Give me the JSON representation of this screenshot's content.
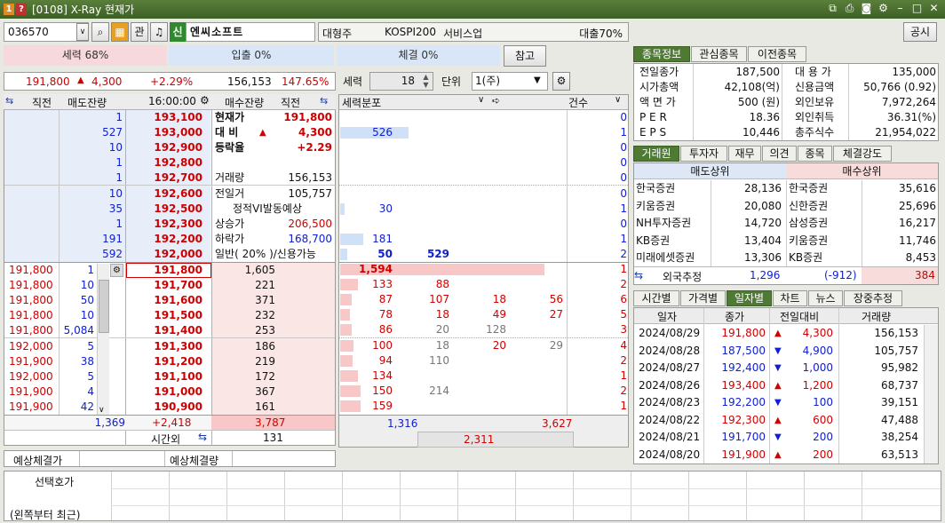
{
  "window": {
    "title": "[0108] X-Ray 현재가"
  },
  "toolbar": {
    "code": "036570",
    "gwan": "관",
    "sin": "신",
    "name": "엔씨소프트",
    "info": [
      "대형주",
      "KOSPI200",
      "서비스업"
    ],
    "loan": "대출70%",
    "notice": "공시"
  },
  "strength": {
    "seryeok": "세력 68%",
    "inout": "입출 0%",
    "chegyeol": "체결 0%",
    "ref": "참고"
  },
  "quote": {
    "price": "191,800",
    "change": "4,300",
    "rate": "+2.29%",
    "volume": "156,153",
    "ratio": "147.65%"
  },
  "seryeok_ctrl": {
    "label": "세력",
    "value": "18",
    "unit_label": "단위",
    "unit": "1(주)"
  },
  "ob_header": {
    "jikjeon1": "직전",
    "sell_rem": "매도잔량",
    "time": "16:00:00",
    "buy_rem": "매수잔량",
    "jikjeon2": "직전"
  },
  "ask": [
    {
      "rem": "1",
      "price": "193,100"
    },
    {
      "rem": "527",
      "price": "193,000"
    },
    {
      "rem": "10",
      "price": "192,900"
    },
    {
      "rem": "1",
      "price": "192,800"
    },
    {
      "rem": "1",
      "price": "192,700"
    },
    {
      "rem": "10",
      "price": "192,600"
    },
    {
      "rem": "35",
      "price": "192,500"
    },
    {
      "rem": "1",
      "price": "192,300"
    },
    {
      "rem": "191",
      "price": "192,200"
    },
    {
      "rem": "592",
      "price": "192,000"
    }
  ],
  "info": [
    {
      "k": "현재가",
      "v": "191,800"
    },
    {
      "k": "대 비",
      "arrow": "▲",
      "v": "4,300"
    },
    {
      "k": "등락율",
      "v": "+2.29"
    },
    {
      "k": "",
      "v": ""
    },
    {
      "k": "거래량",
      "v": "156,153"
    },
    {
      "k": "전일거",
      "v": "105,757"
    },
    {
      "k": "정적VI발동예상",
      "v": ""
    },
    {
      "k": "상승가",
      "v": "206,500"
    },
    {
      "k": "하락가",
      "v": "168,700"
    },
    {
      "k": "일반( 20% )/신용가능",
      "v": ""
    }
  ],
  "bid": [
    {
      "prev": "191,800",
      "rem": "1",
      "price": "191,800",
      "brem": "1,605"
    },
    {
      "prev": "191,800",
      "rem": "10",
      "price": "191,700",
      "brem": "221"
    },
    {
      "prev": "191,800",
      "rem": "50",
      "price": "191,600",
      "brem": "371"
    },
    {
      "prev": "191,800",
      "rem": "10",
      "price": "191,500",
      "brem": "232"
    },
    {
      "prev": "191,800",
      "rem": "5,084",
      "price": "191,400",
      "brem": "253"
    },
    {
      "prev": "192,000",
      "rem": "5",
      "price": "191,300",
      "brem": "186"
    },
    {
      "prev": "191,900",
      "rem": "38",
      "price": "191,200",
      "brem": "219"
    },
    {
      "prev": "192,000",
      "rem": "5",
      "price": "191,100",
      "brem": "172"
    },
    {
      "prev": "191,900",
      "rem": "4",
      "price": "191,000",
      "brem": "367"
    },
    {
      "prev": "191,900",
      "rem": "42",
      "price": "190,900",
      "brem": "161"
    }
  ],
  "ob_totals": {
    "sell": "1,369",
    "diff": "+2,418",
    "buy": "3,787",
    "after_label": "시간외",
    "after_val": "131"
  },
  "expected": {
    "price_label": "예상체결가",
    "vol_label": "예상체결량"
  },
  "dist_header": {
    "title": "세력분포",
    "count": "건수"
  },
  "dist": [
    {
      "a": "",
      "b": "",
      "c": "",
      "d": "",
      "n": "0"
    },
    {
      "a": "526",
      "b": "",
      "c": "",
      "d": "",
      "n": "1"
    },
    {
      "a": "",
      "b": "",
      "c": "",
      "d": "",
      "n": "0"
    },
    {
      "a": "",
      "b": "",
      "c": "",
      "d": "",
      "n": "0"
    },
    {
      "a": "",
      "b": "",
      "c": "",
      "d": "",
      "n": "0"
    },
    {
      "a": "",
      "b": "",
      "c": "",
      "d": "",
      "n": "0"
    },
    {
      "a": "30",
      "b": "",
      "c": "",
      "d": "",
      "n": "1"
    },
    {
      "a": "",
      "b": "",
      "c": "",
      "d": "",
      "n": "0"
    },
    {
      "a": "181",
      "b": "",
      "c": "",
      "d": "",
      "n": "1"
    },
    {
      "a": "50",
      "b": "529",
      "c": "",
      "d": "",
      "n": "2"
    },
    {
      "a": "1,594",
      "b": "",
      "c": "",
      "d": "",
      "n": "1"
    },
    {
      "a": "133",
      "b": "88",
      "c": "",
      "d": "",
      "n": "2"
    },
    {
      "a": "87",
      "b": "107",
      "c": "18",
      "d": "56",
      "n": "6"
    },
    {
      "a": "78",
      "b": "18",
      "c": "49",
      "d": "27",
      "n": "5"
    },
    {
      "a": "86",
      "b": "20",
      "c": "128",
      "d": "",
      "n": "3"
    },
    {
      "a": "100",
      "b": "18",
      "c": "20",
      "d": "29",
      "n": "4"
    },
    {
      "a": "94",
      "b": "110",
      "c": "",
      "d": "",
      "n": "2"
    },
    {
      "a": "134",
      "b": "",
      "c": "",
      "d": "",
      "n": "1"
    },
    {
      "a": "150",
      "b": "214",
      "c": "",
      "d": "",
      "n": "2"
    },
    {
      "a": "159",
      "b": "",
      "c": "",
      "d": "",
      "n": "1"
    }
  ],
  "dist_bar": [
    0,
    0.3,
    0,
    0,
    0,
    0,
    0.02,
    0,
    0.1,
    0.03,
    0.9,
    0.08,
    0.05,
    0.045,
    0.05,
    0.06,
    0.055,
    0.08,
    0.09,
    0.09
  ],
  "dist_totals": {
    "a": "1,316",
    "b": "3,627",
    "c": "2,311"
  },
  "tabs1": [
    "종목정보",
    "관심종목",
    "이전종목"
  ],
  "stockinfo": [
    {
      "k1": "전일종가",
      "v1": "187,500",
      "k2": "대 용 가",
      "v2": "135,000"
    },
    {
      "k1": "시가총액",
      "v1": "42,108(억)",
      "k2": "신용금액",
      "v2": "50,766  (0.92)"
    },
    {
      "k1": "액 면 가",
      "v1": "500 (원)",
      "k2": "외인보유",
      "v2": "7,972,264"
    },
    {
      "k1": "P E R",
      "v1": "18.36",
      "k2": "외인취득",
      "v2": "36.31(%)"
    },
    {
      "k1": "E P S",
      "v1": "10,446",
      "k2": "총주식수",
      "v2": "21,954,022"
    }
  ],
  "tabs2": [
    "거래원",
    "투자자",
    "재무",
    "의견",
    "종목",
    "체결강도"
  ],
  "broker_header": {
    "sell": "매도상위",
    "buy": "매수상위"
  },
  "brokers": [
    {
      "s": "한국증권",
      "sv": "28,136",
      "b": "한국증권",
      "bv": "35,616"
    },
    {
      "s": "키움증권",
      "sv": "20,080",
      "b": "신한증권",
      "bv": "25,696"
    },
    {
      "s": "NH투자증권",
      "sv": "14,720",
      "b": "삼성증권",
      "bv": "16,217"
    },
    {
      "s": "KB증권",
      "sv": "13,404",
      "b": "키움증권",
      "bv": "11,746"
    },
    {
      "s": "미래에셋증권",
      "sv": "13,306",
      "b": "KB증권",
      "bv": "8,453"
    }
  ],
  "foreign": {
    "label": "외국추정",
    "sell": "1,296",
    "net": "(-912)",
    "buy": "384"
  },
  "tabs3": [
    "시간별",
    "가격별",
    "일자별",
    "차트",
    "뉴스",
    "장중추정"
  ],
  "daily_header": {
    "date": "일자",
    "close": "종가",
    "change": "전일대비",
    "volume": "거래량"
  },
  "daily": [
    {
      "date": "2024/08/29",
      "close": "191,800",
      "dir": "▲",
      "chg": "4,300",
      "vol": "156,153",
      "up": true
    },
    {
      "date": "2024/08/28",
      "close": "187,500",
      "dir": "▼",
      "chg": "4,900",
      "vol": "105,757",
      "up": false
    },
    {
      "date": "2024/08/27",
      "close": "192,400",
      "dir": "▼",
      "chg": "1,000",
      "vol": "95,982",
      "up": false
    },
    {
      "date": "2024/08/26",
      "close": "193,400",
      "dir": "▲",
      "chg": "1,200",
      "vol": "68,737",
      "up": true
    },
    {
      "date": "2024/08/23",
      "close": "192,200",
      "dir": "▼",
      "chg": "100",
      "vol": "39,151",
      "up": false
    },
    {
      "date": "2024/08/22",
      "close": "192,300",
      "dir": "▲",
      "chg": "600",
      "vol": "47,488",
      "up": true
    },
    {
      "date": "2024/08/21",
      "close": "191,700",
      "dir": "▼",
      "chg": "200",
      "vol": "38,254",
      "up": false
    },
    {
      "date": "2024/08/20",
      "close": "191,900",
      "dir": "▲",
      "chg": "200",
      "vol": "63,513",
      "up": true
    }
  ],
  "bottom": {
    "label1": "선택호가",
    "label2": "(왼쪽부터 최근)"
  }
}
